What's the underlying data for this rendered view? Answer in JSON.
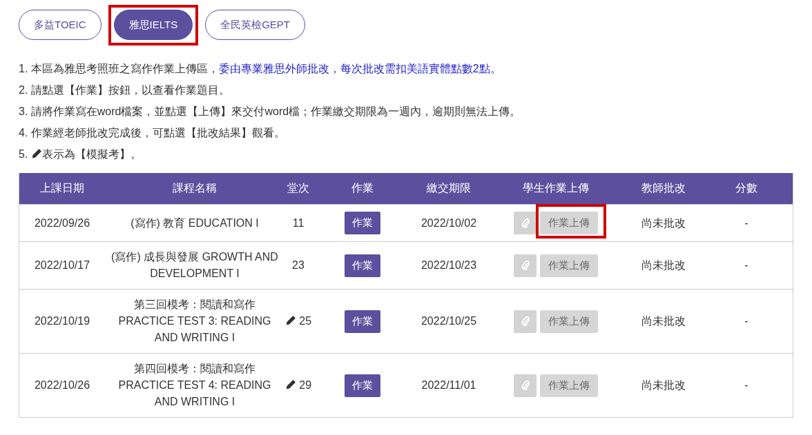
{
  "tabs": [
    {
      "label": "多益TOEIC",
      "selected": false,
      "highlighted": false
    },
    {
      "label": "雅思IELTS",
      "selected": true,
      "highlighted": true
    },
    {
      "label": "全民英檢GEPT",
      "selected": false,
      "highlighted": false
    }
  ],
  "notes": [
    {
      "kind": "text",
      "number": "1.",
      "text": "本區為雅思考照班之寫作作業上傳區，",
      "emphasis": "委由專業雅思外師批改，每次批改需扣美語實體點數2點。"
    },
    {
      "kind": "text",
      "number": "2.",
      "text": "請點選【作業】按鈕，以查看作業題目。"
    },
    {
      "kind": "text",
      "number": "3.",
      "text": "請將作業寫在word檔案，並點選【上傳】來交付word檔；作業繳交期限為一週內，逾期則無法上傳。"
    },
    {
      "kind": "text",
      "number": "4.",
      "text": "作業經老師批改完成後，可點選【批改結果】觀看。"
    },
    {
      "kind": "pencil",
      "number": "5.",
      "text": "表示為【模擬考】。"
    }
  ],
  "table": {
    "columns": [
      "上課日期",
      "課程名稱",
      "堂次",
      "作業",
      "繳交期限",
      "學生作業上傳",
      "教師批改",
      "分數"
    ],
    "rows": [
      {
        "date": "2022/09/26",
        "course": "(寫作) 教育 EDUCATION I",
        "mock": false,
        "session": "11",
        "homework": "作業",
        "deadline": "2022/10/02",
        "upload": "作業上傳",
        "upload_disabled": true,
        "upload_highlighted": true,
        "review": "尚未批改",
        "score": "-"
      },
      {
        "date": "2022/10/17",
        "course": "(寫作) 成長與發展 GROWTH AND DEVELOPMENT I",
        "mock": false,
        "session": "23",
        "homework": "作業",
        "deadline": "2022/10/23",
        "upload": "作業上傳",
        "upload_disabled": true,
        "upload_highlighted": false,
        "review": "尚未批改",
        "score": "-"
      },
      {
        "date": "2022/10/19",
        "course": "第三回模考：閱讀和寫作\nPRACTICE TEST 3: READING AND WRITING I",
        "mock": true,
        "session": "25",
        "homework": "作業",
        "deadline": "2022/10/25",
        "upload": "作業上傳",
        "upload_disabled": true,
        "upload_highlighted": false,
        "review": "尚未批改",
        "score": "-"
      },
      {
        "date": "2022/10/26",
        "course": "第四回模考：閱讀和寫作\nPRACTICE TEST 4: READING AND WRITING I",
        "mock": true,
        "session": "29",
        "homework": "作業",
        "deadline": "2022/11/01",
        "upload": "作業上傳",
        "upload_disabled": true,
        "upload_highlighted": false,
        "review": "尚未批改",
        "score": "-"
      }
    ]
  }
}
